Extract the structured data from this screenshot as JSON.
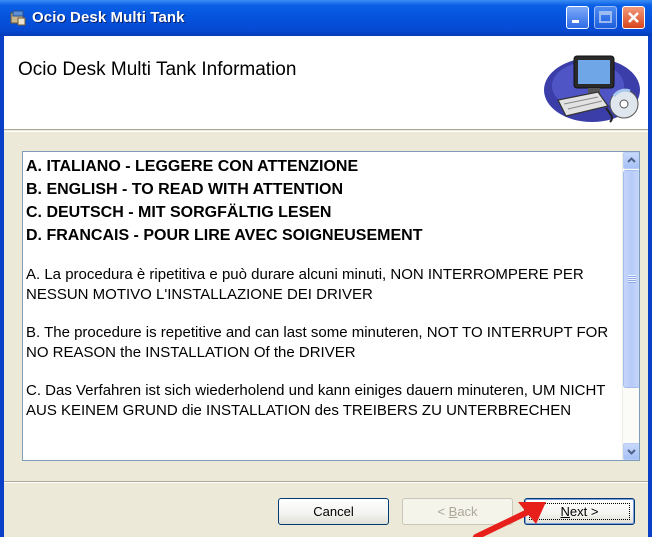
{
  "window": {
    "title": "Ocio Desk Multi Tank"
  },
  "header": {
    "title": "Ocio Desk Multi Tank Information"
  },
  "license_text": {
    "headings": [
      "A.  ITALIANO - LEGGERE CON ATTENZIONE",
      "B.  ENGLISH - TO READ WITH ATTENTION",
      "C.  DEUTSCH - MIT SORGFÄLTIG LESEN",
      "D.  FRANCAIS - POUR LIRE AVEC SOIGNEUSEMENT"
    ],
    "paragraphs": [
      "A. La procedura è ripetitiva e può durare alcuni minuti, NON INTERROMPERE PER NESSUN MOTIVO L'INSTALLAZIONE DEI DRIVER",
      "B. The procedure is repetitive and can last some minuteren, NOT TO INTERRUPT FOR NO REASON the INSTALLATION Of the DRIVER",
      "C. Das Verfahren ist sich wiederholend und kann einiges dauern minuteren, UM NICHT AUS KEINEM GRUND die INSTALLATION des TREIBERS ZU UNTERBRECHEN"
    ]
  },
  "buttons": {
    "cancel": "Cancel",
    "back_accel": "B",
    "back_rest": "ack",
    "back_prefix": "< ",
    "next_accel": "N",
    "next_rest": "ext",
    "next_suffix": " >"
  },
  "icons": {
    "title_icon": "installer-icon",
    "header_graphic": "computer-cd-icon",
    "annotation": "red-arrow-icon"
  },
  "colors": {
    "titlebar": "#0553dd",
    "annotation_arrow": "#e8201c"
  }
}
